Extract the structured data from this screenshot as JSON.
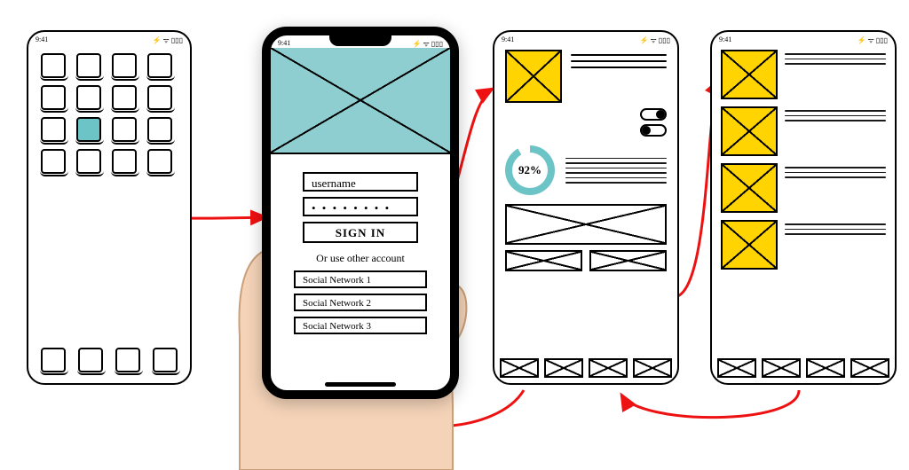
{
  "statusbar": {
    "time": "9:41",
    "indicators": "⚡ ᯤ ▯▯▯"
  },
  "screen1": {
    "selected_index": 9
  },
  "screen2": {
    "username_label": "username",
    "password_mask": "• • • • • • • •",
    "signin_label": "SIGN IN",
    "alt_label": "Or use other account",
    "social": [
      "Social Network 1",
      "Social Network 2",
      "Social Network 3"
    ]
  },
  "screen3": {
    "progress_label": "92%",
    "progress_value": 92,
    "toggles": [
      "on",
      "off"
    ]
  },
  "screen4": {
    "list_count": 4
  }
}
